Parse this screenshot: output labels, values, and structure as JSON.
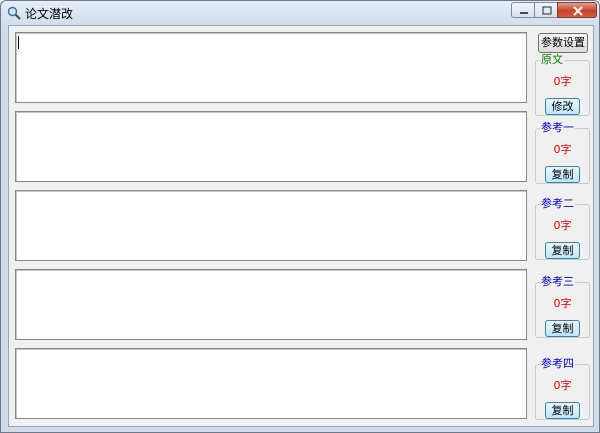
{
  "window": {
    "title": "论文潜改",
    "controls": [
      "minimize",
      "maximize",
      "close"
    ]
  },
  "toolbar": {
    "settings_label": "参数设置"
  },
  "panels": [
    {
      "label": "原文",
      "label_color": "#008000",
      "count": "0字",
      "button_label": "修改"
    },
    {
      "label": "参考一",
      "label_color": "#0000cc",
      "count": "0字",
      "button_label": "复制"
    },
    {
      "label": "参考二",
      "label_color": "#0000cc",
      "count": "0字",
      "button_label": "复制"
    },
    {
      "label": "参考三",
      "label_color": "#0000cc",
      "count": "0字",
      "button_label": "复制"
    },
    {
      "label": "参考四",
      "label_color": "#0000cc",
      "count": "0字",
      "button_label": "复制"
    }
  ]
}
